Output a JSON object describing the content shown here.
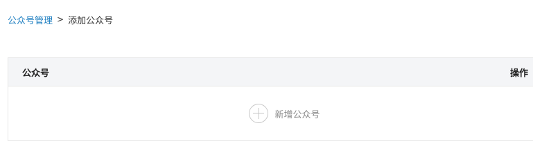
{
  "breadcrumb": {
    "parent": "公众号管理",
    "separator": ">",
    "current": "添加公众号"
  },
  "table": {
    "columns": {
      "name": "公众号",
      "actions": "操作"
    },
    "add_button_label": "新增公众号"
  },
  "icons": {
    "add": "plus-circle-icon"
  },
  "colors": {
    "link": "#1f7fc1",
    "header_bg": "#f4f5f7",
    "border": "#e6e6e6",
    "muted_text": "#888888"
  }
}
